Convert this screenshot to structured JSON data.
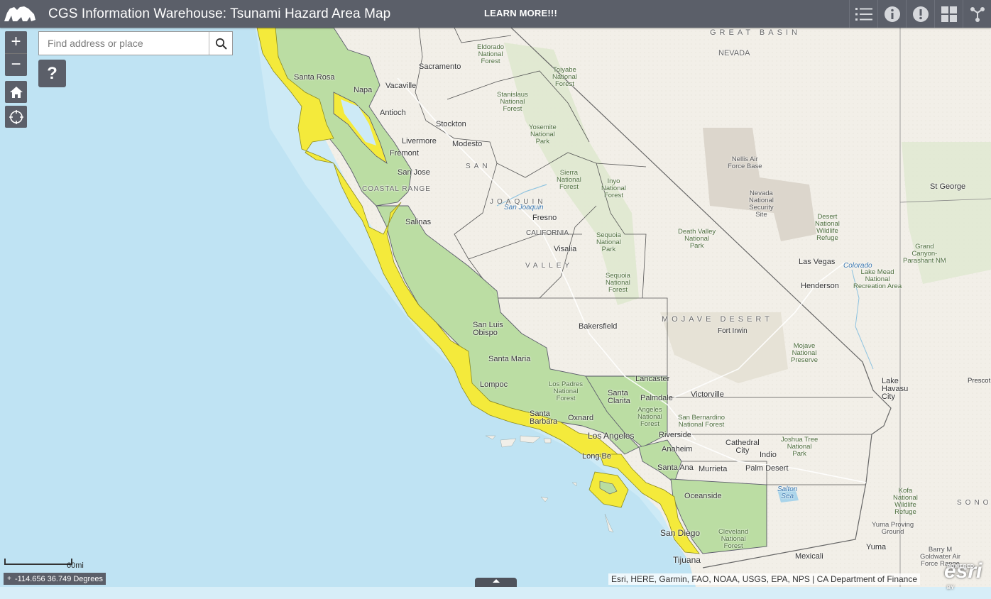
{
  "header": {
    "title": "CGS Information Warehouse: Tsunami Hazard Area Map",
    "learn_more": "LEARN MORE!!!",
    "buttons": [
      "list-icon",
      "info-icon",
      "alert-icon",
      "grid-icon",
      "share-icon"
    ]
  },
  "search": {
    "placeholder": "Find address or place"
  },
  "widgets": {
    "zoom_in": "+",
    "zoom_out": "−",
    "help": "?"
  },
  "scale": {
    "label": "60mi"
  },
  "coordinates": {
    "value": "-114.656 36.749 Degrees"
  },
  "attribution": "Esri, HERE, Garmin, FAO, NOAA, USGS, EPA, NPS | CA Department of Finance",
  "esri_logo": {
    "small": "POWERED BY",
    "text": "esri"
  },
  "colors": {
    "header": "#5b5f69",
    "ocean": "#cfeaf6",
    "hazard_zone": "#f4e93a",
    "county_fill": "#b8dc9c",
    "land": "#f1efe9"
  },
  "map_labels": {
    "great_basin": "GREAT BASIN",
    "nevada": "NEVADA",
    "mojave_desert": "MOJAVE DESERT",
    "california": "CALIFORNIA",
    "coastal_range": "COASTAL RANGE",
    "san": "SAN",
    "joaquin": "JOAQUIN",
    "valley": "VALLEY",
    "sono": "SONO",
    "cities": {
      "sacramento": "Sacramento",
      "vacaville": "Vacaville",
      "antioch": "Antioch",
      "stockton": "Stockton",
      "livermore": "Livermore",
      "modesto": "Modesto",
      "fremont": "Fremont",
      "san_jose": "San Jose",
      "santa_rosa": "Santa Rosa",
      "napa": "Napa",
      "salinas": "Salinas",
      "fresno": "Fresno",
      "visalia": "Visalia",
      "bakersfield": "Bakersfield",
      "san_luis_obispo": "San Luis\nObispo",
      "santa_maria": "Santa Maria",
      "lompoc": "Lompoc",
      "santa_barbara": "Santa\nBarbara",
      "oxnard": "Oxnard",
      "santa_clarita": "Santa\nClarita",
      "lancaster": "Lancaster",
      "palmdale": "Palmdale",
      "victorville": "Victorville",
      "los_angeles": "Los Angeles",
      "long_beach": "Long Be",
      "riverside": "Riverside",
      "anaheim": "Anaheim",
      "santa_ana": "Santa Ana",
      "murrieta": "Murrieta",
      "palm_desert": "Palm Desert",
      "indio": "Indio",
      "cathedral_city": "Cathedral\nCity",
      "oceanside": "Oceanside",
      "san_diego": "San Diego",
      "tijuana": "Tijuana",
      "mexicali": "Mexicali",
      "yuma": "Yuma",
      "las_vegas": "Las Vegas",
      "henderson": "Henderson",
      "st_george": "St George",
      "lake_havasu": "Lake\nHavasu\nCity",
      "fort_irwin": "Fort Irwin",
      "salton_sea": "Salton\nSea",
      "colorado": "Colorado",
      "san_joaquin": "San Joaquin",
      "prescott": "Prescot"
    },
    "parks": {
      "eldorado": "Eldorado\nNational\nForest",
      "toiyabe": "Toiyabe\nNational\nForest",
      "stanislaus": "Stanislaus\nNational\nForest",
      "yosemite": "Yosemite\nNational\nPark",
      "sierra": "Sierra\nNational\nForest",
      "inyo": "Inyo\nNational\nForest",
      "nellis": "Nellis Air\nForce Base",
      "nevada_security": "Nevada\nNational\nSecurity\nSite",
      "desert_refuge": "Desert\nNational\nWildlife\nRefuge",
      "death_valley": "Death Valley\nNational\nPark",
      "sequoia_park": "Sequoia\nNational\nPark",
      "sequoia_forest": "Sequoia\nNational\nForest",
      "grand_canyon": "Grand\nCanyon-\nParashant NM",
      "lake_mead": "Lake Mead\nNational\nRecreation Area",
      "mojave_preserve": "Mojave\nNational\nPreserve",
      "los_padres": "Los Padres\nNational\nForest",
      "angeles": "Angeles\nNational\nForest",
      "san_bernardino": "San Bernardino\nNational Forest",
      "joshua_tree": "Joshua Tree\nNational\nPark",
      "cleveland": "Cleveland\nNational\nForest",
      "kofa": "Kofa\nNational\nWildlife\nRefuge",
      "yuma_proving": "Yuma Proving\nGround",
      "barry": "Barry M\nGoldwater Air\nForce Range"
    }
  }
}
